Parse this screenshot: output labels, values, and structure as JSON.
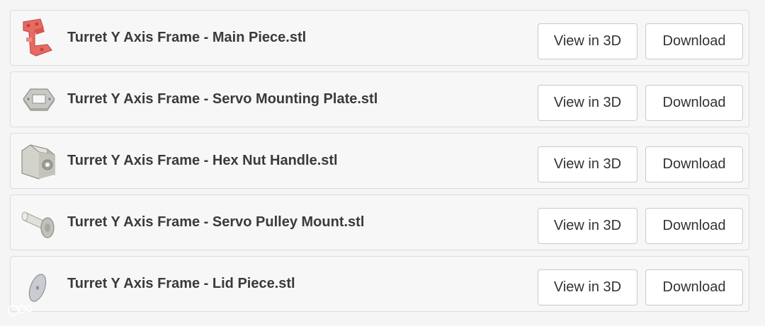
{
  "files": [
    {
      "name": "Turret Y Axis Frame - Main Piece.stl",
      "thumbnail_icon": "main-piece-part-icon",
      "view_label": "View in 3D",
      "download_label": "Download"
    },
    {
      "name": "Turret Y Axis Frame - Servo Mounting Plate.stl",
      "thumbnail_icon": "servo-mounting-plate-part-icon",
      "view_label": "View in 3D",
      "download_label": "Download"
    },
    {
      "name": "Turret Y Axis Frame - Hex Nut Handle.stl",
      "thumbnail_icon": "hex-nut-handle-part-icon",
      "view_label": "View in 3D",
      "download_label": "Download"
    },
    {
      "name": "Turret Y Axis Frame - Servo Pulley Mount.stl",
      "thumbnail_icon": "servo-pulley-mount-part-icon",
      "view_label": "View in 3D",
      "download_label": "Download"
    },
    {
      "name": "Turret Y Axis Frame - Lid Piece.stl",
      "thumbnail_icon": "lid-piece-part-icon",
      "view_label": "View in 3D",
      "download_label": "Download"
    }
  ],
  "watermark": {
    "icon": "watermark-logo-icon"
  },
  "colors": {
    "row_bg": "#f7f7f7",
    "row_border": "#dcdcdc",
    "button_bg": "#ffffff",
    "button_border": "#c9c9c9",
    "text": "#3a3a3a",
    "main_piece_part": "#e96a63",
    "gray_part": "#c8c8c4"
  }
}
